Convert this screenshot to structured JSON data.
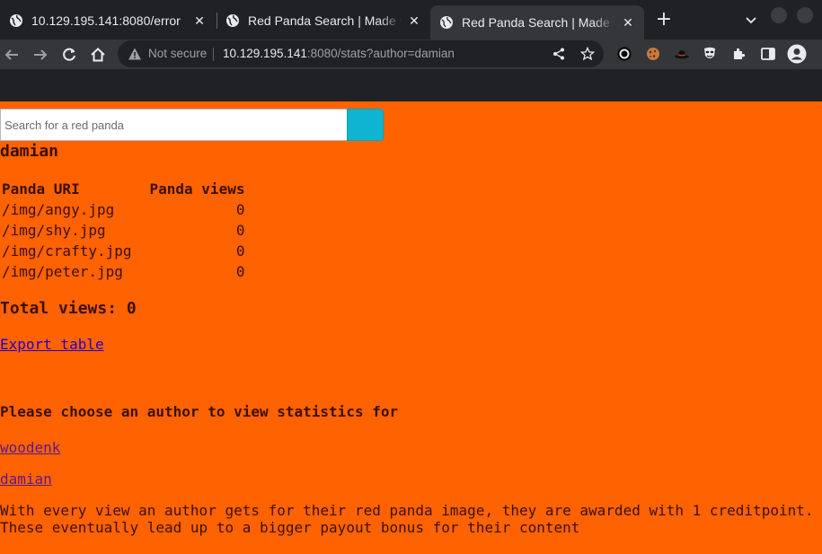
{
  "browser": {
    "tabs": [
      {
        "title": "10.129.195.141:8080/error",
        "active": false
      },
      {
        "title": "Red Panda Search | Made with Spring Boot",
        "active": false
      },
      {
        "title": "Red Panda Search | Made with Spring Boot",
        "active": true
      }
    ],
    "new_tab_label": "+",
    "omnibox": {
      "security_label": "Not secure",
      "host": "10.129.195.141",
      "rest": ":8080/stats?author=damian"
    },
    "icons": [
      "back-icon",
      "forward-icon",
      "reload-icon",
      "home-icon",
      "warning-icon",
      "share-icon",
      "star-icon",
      "extensions-icon",
      "sidepanel-icon",
      "profile-icon"
    ]
  },
  "page": {
    "search": {
      "placeholder": "Search for a red panda",
      "value": ""
    },
    "author": "damian",
    "table": {
      "headers": [
        "Panda URI",
        "Panda views"
      ],
      "rows": [
        {
          "uri": "/img/angy.jpg",
          "views": "0"
        },
        {
          "uri": "/img/shy.jpg",
          "views": "0"
        },
        {
          "uri": "/img/crafty.jpg",
          "views": "0"
        },
        {
          "uri": "/img/peter.jpg",
          "views": "0"
        }
      ]
    },
    "total": "Total views: 0",
    "export_label": "Export table",
    "choose_heading": "Please choose an author to view statistics for",
    "authors": [
      "woodenk",
      "damian"
    ],
    "footer_line1": "With every view an author gets for their red panda image, they are awarded with 1 creditpoint.",
    "footer_line2": "These eventually lead up to a bigger payout bonus for their content"
  },
  "colors": {
    "page_background": "#ff6200",
    "search_button": "#0fb4d0",
    "text": "#3a1000"
  }
}
